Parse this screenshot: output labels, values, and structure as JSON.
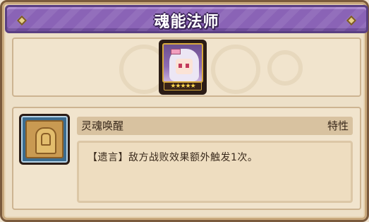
{
  "header": {
    "title": "魂能法师"
  },
  "hero": {
    "portrait_icon": "silver-haired-mage-portrait",
    "star_count": 5,
    "stars": "★★★★★"
  },
  "skill": {
    "icon": "soul-plaque-icon",
    "name": "灵魂唤醒",
    "type": "特性",
    "description": "【遗言】敌方战败效果额外触发1次。"
  },
  "colors": {
    "title_bar": "#8a63b6",
    "panel_bg": "#f1e4cd",
    "frame_border": "#7a5a3c"
  }
}
